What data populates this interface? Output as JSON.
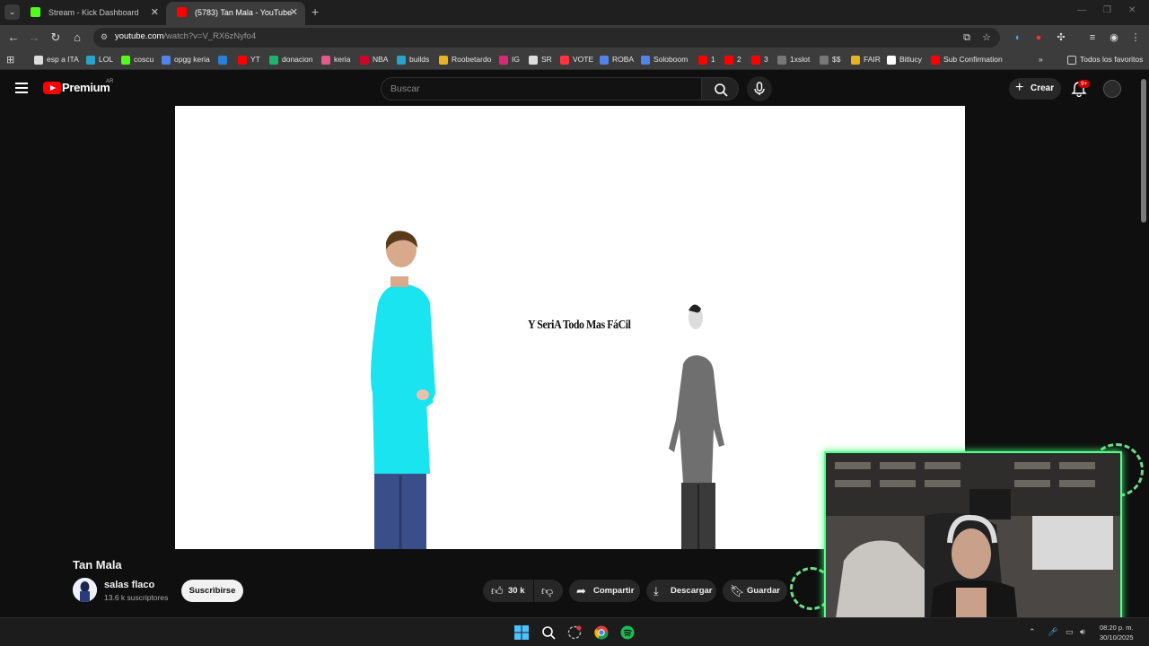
{
  "browser": {
    "tabs": [
      {
        "title": "Stream - Kick Dashboard",
        "active": false,
        "favicon_color": "#53fc18"
      },
      {
        "title": "(5783) Tan Mala - YouTube",
        "active": true,
        "favicon_color": "#ff0000"
      }
    ],
    "address": {
      "host": "youtube.com",
      "path": "/watch?v=V_RX6zNyfo4"
    },
    "bookmarks": [
      {
        "label": "esp a ITA",
        "color": "#dddddd"
      },
      {
        "label": "LOL",
        "color": "#2aa3c9"
      },
      {
        "label": "coscu",
        "color": "#53fc18"
      },
      {
        "label": "opgg keria",
        "color": "#5383e8"
      },
      {
        "label": "",
        "color": "#2a7fd6"
      },
      {
        "label": "YT",
        "color": "#ff0000"
      },
      {
        "label": "donacion",
        "color": "#1fb36b"
      },
      {
        "label": "keria",
        "color": "#e05a8a"
      },
      {
        "label": "NBA",
        "color": "#c9082a"
      },
      {
        "label": "builds",
        "color": "#2aa3c9"
      },
      {
        "label": "Roobetardo",
        "color": "#e6b422"
      },
      {
        "label": "IG",
        "color": "#d62976"
      },
      {
        "label": "SR",
        "color": "#dddddd"
      },
      {
        "label": "VOTE",
        "color": "#ff3344"
      },
      {
        "label": "ROBA",
        "color": "#5383e8"
      },
      {
        "label": "Soloboom",
        "color": "#5383e8"
      },
      {
        "label": "1",
        "color": "#ff0000"
      },
      {
        "label": "2",
        "color": "#ff0000"
      },
      {
        "label": "3",
        "color": "#ff0000"
      },
      {
        "label": "1xslot",
        "color": "#777777"
      },
      {
        "label": "$$",
        "color": "#777777"
      },
      {
        "label": "FAIR",
        "color": "#e6b422"
      },
      {
        "label": "Bitlucy",
        "color": "#ffffff"
      },
      {
        "label": "Sub Confirmation",
        "color": "#ff0000"
      }
    ],
    "all_bookmarks_label": "Todos los favoritos"
  },
  "youtube": {
    "brand": "Premium",
    "country": "AR",
    "search_placeholder": "Buscar",
    "create_label": "Crear",
    "notifications_badge": "9+",
    "video": {
      "caption": "Y SeriA Todo Mas FáCil",
      "title": "Tan Mala"
    },
    "channel": {
      "name": "salas flaco",
      "subscribers": "13.6 k suscriptores"
    },
    "subscribe_label": "Suscribirse",
    "likes": "30 k",
    "share_label": "Compartir",
    "download_label": "Descargar",
    "save_label": "Guardar"
  },
  "taskbar": {
    "time": "08:20 p. m.",
    "date": "30/10/2025"
  },
  "colors": {
    "accent_red": "#ff0000",
    "kick_green": "#53fc18",
    "cam_border": "#55ff8a"
  }
}
